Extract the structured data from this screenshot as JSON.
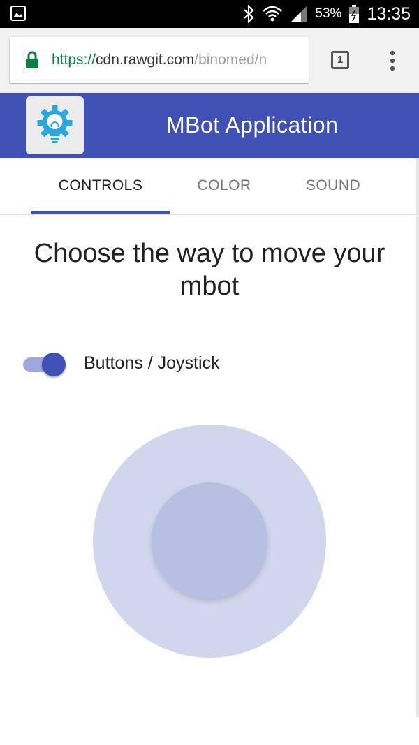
{
  "status_bar": {
    "battery_percent": "53%",
    "time": "13:35",
    "icons": [
      "gallery-icon",
      "bluetooth-icon",
      "wifi-icon",
      "signal-icon",
      "battery-icon"
    ]
  },
  "browser": {
    "url_scheme": "https://",
    "url_host": "cdn.rawgit.com",
    "url_path": "/binomed/n",
    "tab_count": "1",
    "lock_color": "#0b8043"
  },
  "app": {
    "title": "MBot Application",
    "logo_icon": "lightbulb-gear-icon",
    "brand_color": "#3f51b5"
  },
  "tabs": [
    {
      "label": "CONTROLS",
      "active": true
    },
    {
      "label": "COLOR",
      "active": false
    },
    {
      "label": "SOUND",
      "active": false
    }
  ],
  "controls": {
    "heading": "Choose the way to move your mbot",
    "toggle_label": "Buttons / Joystick",
    "toggle_on": true
  }
}
